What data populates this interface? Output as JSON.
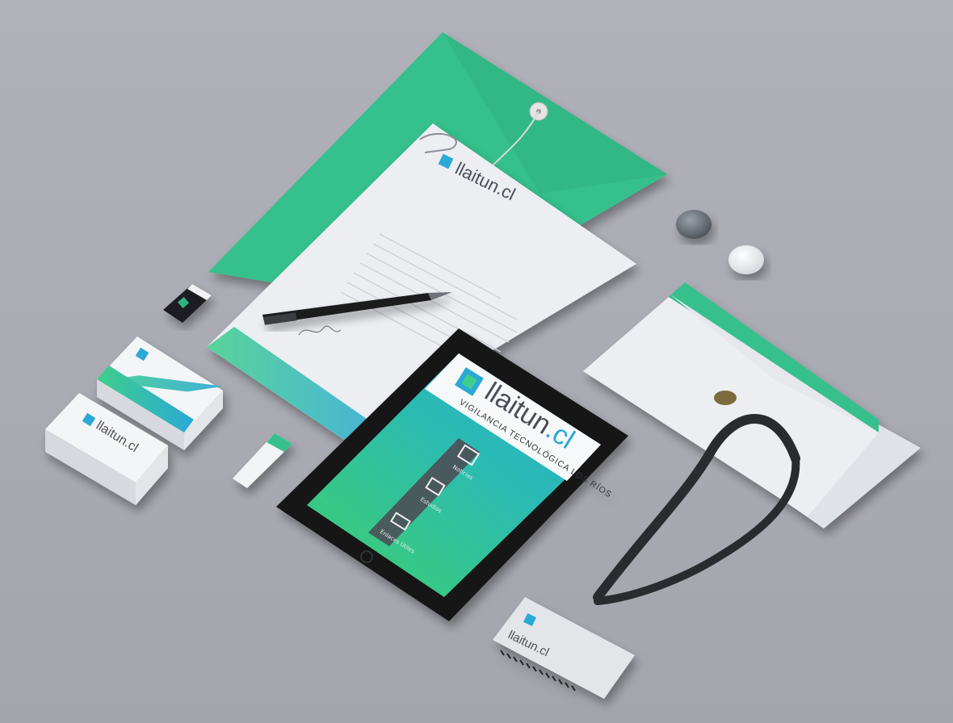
{
  "brand": {
    "name": "llaitun",
    "suffix": ".cl",
    "tagline": "VIGILANCIA TECNOLÓGICA LOS RÍOS"
  },
  "tablet": {
    "menu": [
      "Noticias",
      "Estudios",
      "Enlaces Útiles"
    ]
  },
  "colors": {
    "background": "#a9aab1",
    "envelope_green": "#35c08d",
    "gradient_green": "#3fd06a",
    "gradient_blue": "#1fa9d8",
    "paper": "#eceef2",
    "tablet_bezel": "#141414"
  }
}
